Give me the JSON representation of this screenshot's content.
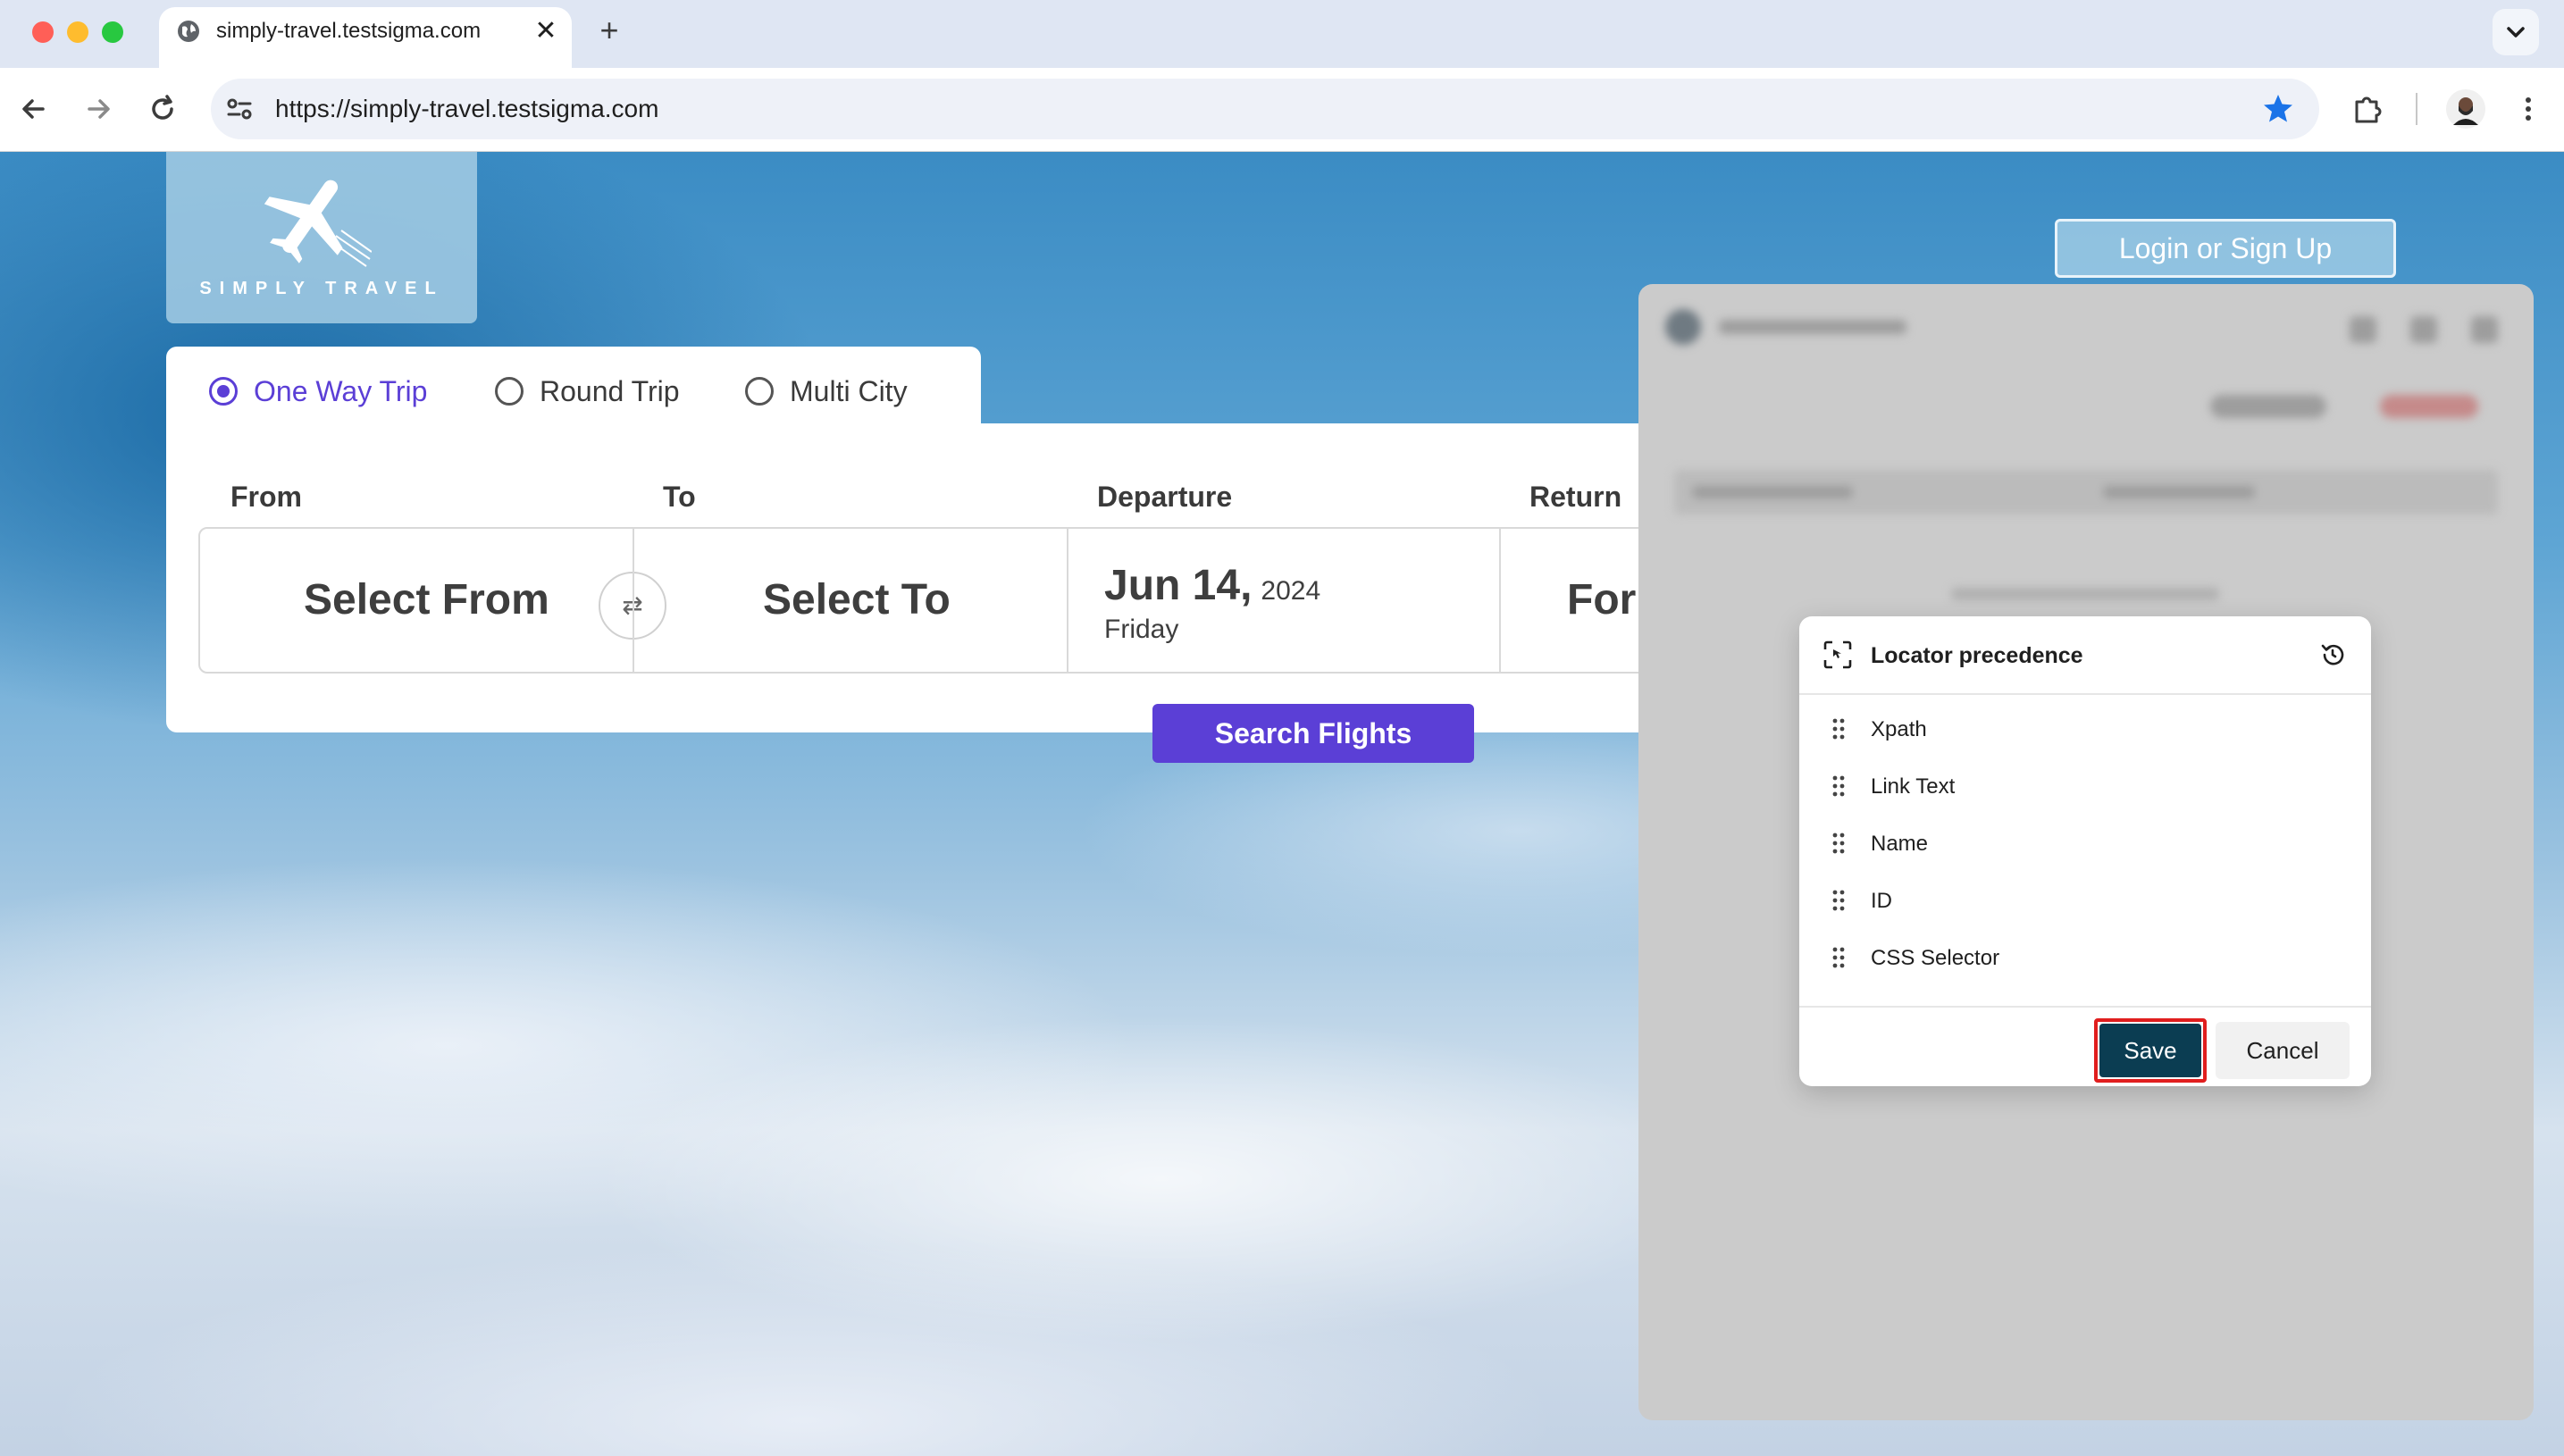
{
  "browser": {
    "tab_title": "simply-travel.testsigma.com",
    "tab_close": "✕",
    "new_tab": "+",
    "url": "https://simply-travel.testsigma.com",
    "colors": {
      "accent_star": "#1a73e8"
    }
  },
  "site": {
    "logo_text": "SIMPLY TRAVEL",
    "login_label": "Login or Sign Up",
    "trip_types": [
      {
        "label": "One Way Trip",
        "checked": true
      },
      {
        "label": "Round Trip",
        "checked": false
      },
      {
        "label": "Multi City",
        "checked": false
      }
    ],
    "fields": {
      "from_label": "From",
      "to_label": "To",
      "departure_label": "Departure",
      "return_label": "Return",
      "from_value": "Select From",
      "to_value": "Select To",
      "swap_icon": "⇄",
      "departure_date": "Jun 14,",
      "departure_year": "2024",
      "departure_day": "Friday",
      "return_value": "For"
    },
    "search_label": "Search Flights",
    "colors": {
      "primary": "#5b3fd6"
    }
  },
  "modal": {
    "title": "Locator precedence",
    "items": [
      "Xpath",
      "Link Text",
      "Name",
      "ID",
      "CSS Selector"
    ],
    "save_label": "Save",
    "cancel_label": "Cancel",
    "colors": {
      "save_bg": "#0b3d52",
      "highlight": "#e01e1e"
    }
  }
}
